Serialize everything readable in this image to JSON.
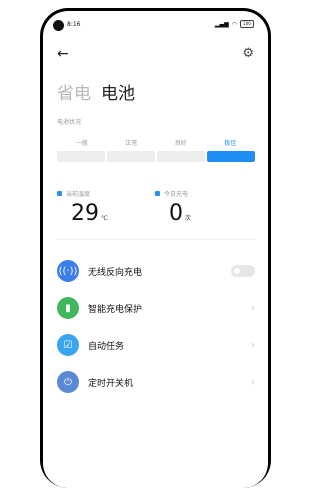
{
  "status": {
    "time": "8:16",
    "battery": "100"
  },
  "header": {
    "back_icon": "back-arrow-icon",
    "settings_icon": "gear-icon",
    "tabs": [
      {
        "label": "省电",
        "active": false
      },
      {
        "label": "电池",
        "active": true
      }
    ]
  },
  "battery_status": {
    "section_label": "电池状况",
    "levels": [
      "一般",
      "正常",
      "良好",
      "极佳"
    ],
    "selected_index": 3
  },
  "stats": {
    "temperature": {
      "label": "当前温度",
      "value": "29",
      "unit": "℃"
    },
    "charges_today": {
      "label": "今日充电",
      "value": "0",
      "unit": "次"
    }
  },
  "features": [
    {
      "label": "无线反向充电",
      "icon": "wireless-charging-icon",
      "color": "#3b7de9",
      "control": "toggle",
      "enabled": false
    },
    {
      "label": "智能充电保护",
      "icon": "battery-protection-icon",
      "color": "#3fb75c",
      "control": "chevron"
    },
    {
      "label": "自动任务",
      "icon": "clipboard-task-icon",
      "color": "#39a4f0",
      "control": "chevron"
    },
    {
      "label": "定时开关机",
      "icon": "power-icon",
      "color": "#5b89d6",
      "control": "chevron"
    }
  ],
  "colors": {
    "accent": "#1e8ef5"
  }
}
